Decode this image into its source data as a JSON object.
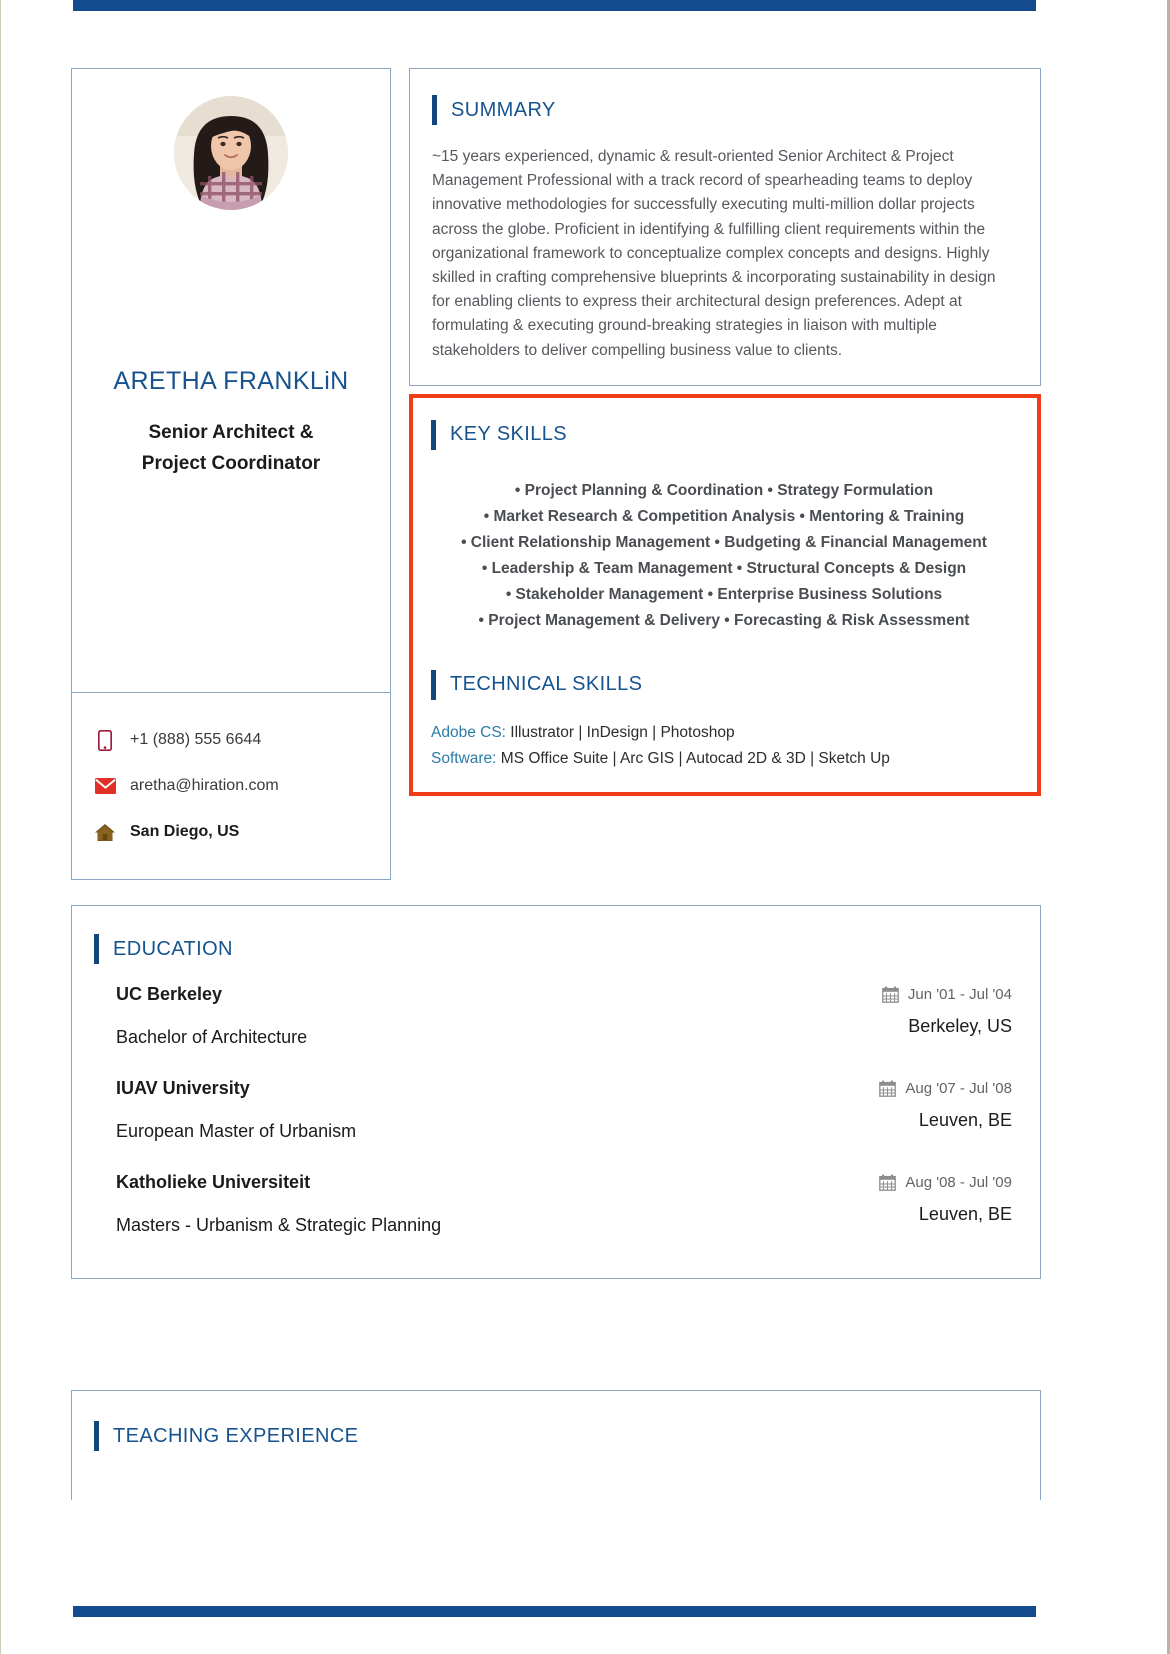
{
  "theme": {
    "accent_blue": "#144a8e",
    "heading_blue": "#17538f",
    "highlight_red": "#f03c17",
    "card_border": "#8aa8c4",
    "tech_label_blue": "#2a7ca8"
  },
  "profile": {
    "photo_alt": "profile-photo",
    "name": "ARETHA FRANKLiN",
    "title_line1": "Senior Architect &",
    "title_line2": "Project Coordinator"
  },
  "contact": {
    "items": [
      {
        "icon": "mobile-phone-icon",
        "value": "+1 (888) 555 6644",
        "bold": false
      },
      {
        "icon": "email-envelope-icon",
        "value": "aretha@hiration.com",
        "bold": false
      },
      {
        "icon": "home-location-icon",
        "value": "San Diego, US",
        "bold": true
      }
    ]
  },
  "summary": {
    "heading": "SUMMARY",
    "text": "~15 years experienced, dynamic & result-oriented Senior Architect & Project Management Professional with a track record of spearheading teams to deploy innovative methodologies for successfully executing multi-million dollar projects across the globe. Proficient in identifying & fulfilling client requirements within the organizational framework to conceptualize complex concepts and designs. Highly skilled in crafting comprehensive blueprints & incorporating sustainability in design for enabling clients to express their architectural design preferences. Adept at formulating & executing ground-breaking strategies in liaison with multiple stakeholders to deliver compelling business value to clients."
  },
  "key_skills": {
    "heading": "KEY SKILLS",
    "lines": [
      "• Project Planning & Coordination • Strategy Formulation",
      "• Market Research & Competition Analysis • Mentoring & Training",
      "• Client Relationship Management • Budgeting & Financial Management",
      "• Leadership & Team Management • Structural Concepts & Design",
      "• Stakeholder Management • Enterprise Business Solutions",
      "• Project Management & Delivery • Forecasting & Risk Assessment"
    ]
  },
  "technical_skills": {
    "heading": "TECHNICAL SKILLS",
    "rows": [
      {
        "label": "Adobe CS:",
        "value": " Illustrator | InDesign | Photoshop"
      },
      {
        "label": "Software:",
        "value": " MS Office Suite | Arc GIS | Autocad 2D & 3D | Sketch Up"
      }
    ]
  },
  "education": {
    "heading": "EDUCATION",
    "entries": [
      {
        "institution": "UC Berkeley",
        "date": "Jun '01 - Jul '04",
        "degree": "Bachelor of Architecture",
        "location": "Berkeley, US"
      },
      {
        "institution": "IUAV University",
        "date": "Aug '07 - Jul '08",
        "degree": "European Master of Urbanism",
        "location": "Leuven, BE"
      },
      {
        "institution": "Katholieke Universiteit",
        "date": "Aug '08 - Jul '09",
        "degree": "Masters - Urbanism & Strategic Planning",
        "location": "Leuven, BE"
      }
    ]
  },
  "teaching": {
    "heading": "TEACHING EXPERIENCE"
  }
}
